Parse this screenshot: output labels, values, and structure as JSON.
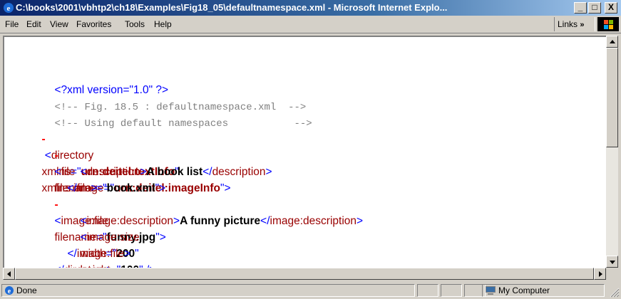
{
  "window": {
    "title": "C:\\books\\2001\\vbhtp2\\ch18\\Examples\\Fig18_05\\defaultnamespace.xml - Microsoft Internet Explo...",
    "buttons": {
      "minimize": "_",
      "maximize": "□",
      "close": "X"
    }
  },
  "menu": {
    "items": [
      "File",
      "Edit",
      "View",
      "Favorites",
      "Tools",
      "Help"
    ],
    "links_label": "Links",
    "links_chevron": "»"
  },
  "document": {
    "decl_open": "<?xml version=\"1.0\" ?>",
    "comment1": "<!-- Fig. 18.5 : defaultnamespace.xml  -->",
    "comment2": "<!-- Using default namespaces           -->",
    "minus": "-",
    "lt": "<",
    "gt": ">",
    "close_lt": "</",
    "eq_q": "=\"",
    "q": "\"",
    "self_close": " />",
    "directory": {
      "tag": "directory",
      "attr1": "xmlns",
      "val1": "urn:deitel:textInfo",
      "attr2": "xmlns:image",
      "val2": "urn:deitel:imageInfo"
    },
    "file": {
      "tag": "file",
      "attr": "filename",
      "val": "book.xml",
      "desc_tag": "description",
      "desc_text": "A book list"
    },
    "image": {
      "tag": "image:file",
      "attr": "filename",
      "val": "funny.jpg",
      "desc_tag": "image:description",
      "desc_text": "A funny picture",
      "size_tag": "image:size",
      "width_attr": "width",
      "width_val": "200",
      "height_attr": "height",
      "height_val": "100"
    }
  },
  "status": {
    "text": "Done",
    "zone": "My Computer"
  },
  "colors": {
    "title_start": "#0a246a",
    "title_end": "#a6caf0",
    "markup": "#0000ff",
    "tag": "#990000",
    "collapse": "#ff0000"
  }
}
